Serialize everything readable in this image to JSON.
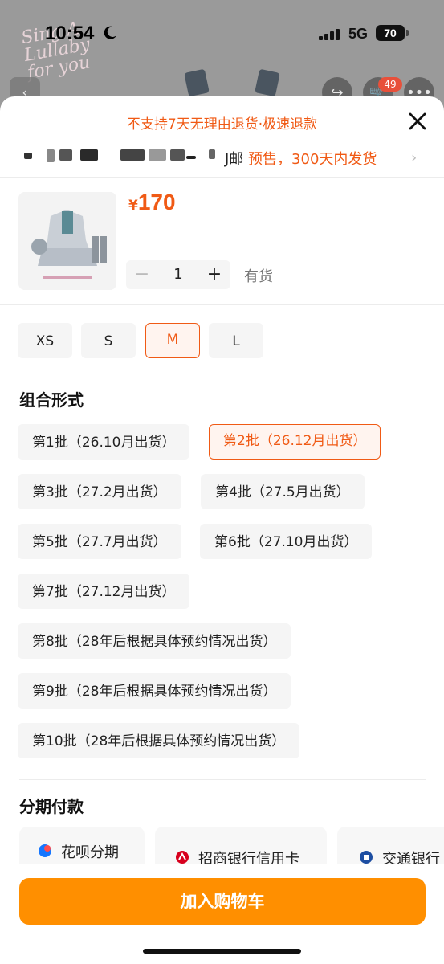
{
  "status_bar": {
    "time": "10:54",
    "network": "5G",
    "battery": "70"
  },
  "background": {
    "cart_badge": "49",
    "decor_text": [
      "Sing A",
      "Lullaby",
      "for you"
    ]
  },
  "notice": "不支持7天无理由退货·极速退款",
  "shipping": {
    "partial_text": "J邮",
    "presale_text": "预售，300天内发货"
  },
  "product": {
    "currency": "¥",
    "price": "170",
    "quantity": "1",
    "minus_label": "−",
    "plus_label": "+",
    "stock_status": "有货"
  },
  "sizes": [
    {
      "label": "XS",
      "selected": false
    },
    {
      "label": "S",
      "selected": false
    },
    {
      "label": "M",
      "selected": true
    },
    {
      "label": "L",
      "selected": false
    }
  ],
  "combo": {
    "title": "组合形式",
    "options": [
      {
        "label": "第1批（26.10月出货）",
        "selected": false
      },
      {
        "label": "第2批（26.12月出货）",
        "selected": true
      },
      {
        "label": "第3批（27.2月出货）",
        "selected": false
      },
      {
        "label": "第4批（27.5月出货）",
        "selected": false
      },
      {
        "label": "第5批（27.7月出货）",
        "selected": false
      },
      {
        "label": "第6批（27.10月出货）",
        "selected": false
      },
      {
        "label": "第7批（27.12月出货）",
        "selected": false
      },
      {
        "label": "第8批（28年后根据具体预约情况出货）",
        "selected": false
      },
      {
        "label": "第9批（28年后根据具体预约情况出货）",
        "selected": false
      },
      {
        "label": "第10批（28年后根据具体预约情况出货）",
        "selected": false
      }
    ]
  },
  "installment": {
    "title": "分期付款",
    "options": [
      {
        "label": "花呗分期",
        "icon": "huabei-icon"
      },
      {
        "label": "招商银行信用卡",
        "icon": "cmb-icon"
      },
      {
        "label": "交通银行",
        "icon": "bocom-icon"
      }
    ]
  },
  "add_to_cart_label": "加入购物车",
  "colors": {
    "accent": "#f05a15",
    "cart_button": "#ff8f00",
    "chip_bg": "#f5f5f5"
  }
}
